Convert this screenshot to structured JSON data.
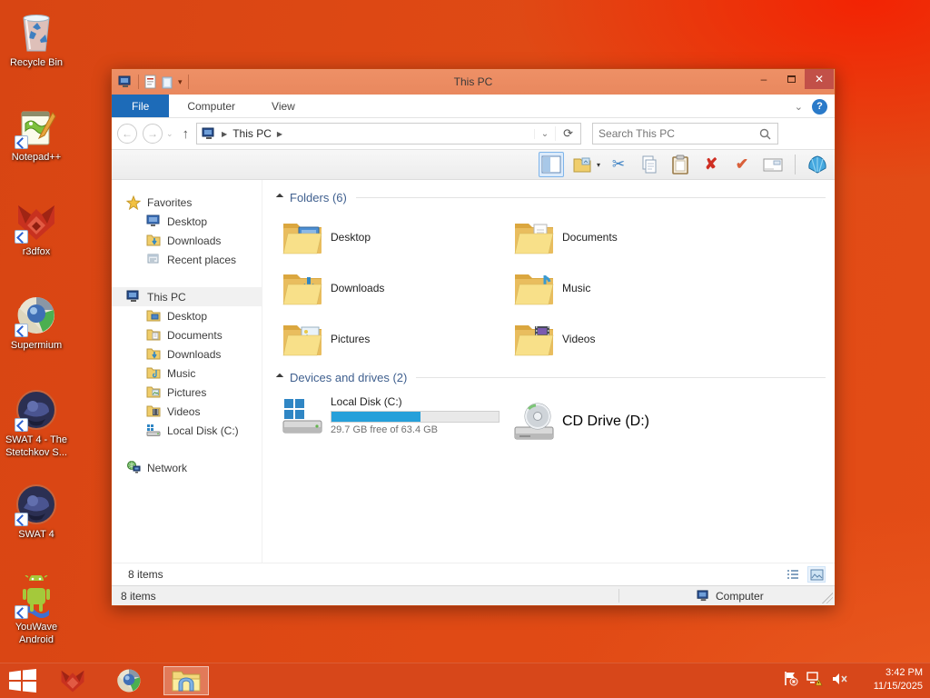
{
  "desktop": {
    "icons": [
      {
        "label": "Recycle Bin"
      },
      {
        "label": "Notepad++"
      },
      {
        "label": "r3dfox"
      },
      {
        "label": "Supermium"
      },
      {
        "label": "SWAT 4 - The Stetchkov S..."
      },
      {
        "label": "SWAT 4"
      },
      {
        "label": "YouWave Android"
      }
    ]
  },
  "window": {
    "title": "This PC",
    "quick_access_icons": [
      "system-menu-computer",
      "properties",
      "new-folder",
      "customize-caret"
    ],
    "tabs": {
      "file": "File",
      "computer": "Computer",
      "view": "View"
    },
    "nav": {
      "address_root": "This PC",
      "search_placeholder": "Search This PC"
    },
    "toolbar_icons": [
      "preview-pane-toggle",
      "folder-options",
      "cut",
      "copy",
      "paste",
      "delete",
      "properties-check",
      "email",
      "classic-shell-settings"
    ],
    "sidebar": {
      "favorites": {
        "label": "Favorites",
        "items": [
          {
            "label": "Desktop"
          },
          {
            "label": "Downloads"
          },
          {
            "label": "Recent places"
          }
        ]
      },
      "thispc": {
        "label": "This PC",
        "items": [
          {
            "label": "Desktop"
          },
          {
            "label": "Documents"
          },
          {
            "label": "Downloads"
          },
          {
            "label": "Music"
          },
          {
            "label": "Pictures"
          },
          {
            "label": "Videos"
          },
          {
            "label": "Local Disk (C:)"
          }
        ]
      },
      "network": {
        "label": "Network"
      }
    },
    "main": {
      "folders": {
        "header": "Folders (6)",
        "items": [
          "Desktop",
          "Documents",
          "Downloads",
          "Music",
          "Pictures",
          "Videos"
        ]
      },
      "devices": {
        "header": "Devices and drives (2)",
        "local_disk": {
          "label": "Local Disk (C:)",
          "free_text": "29.7 GB free of 63.4 GB",
          "used_percent": 53,
          "bar_fill_style": "width:53%",
          "bar_color": "#26a0da"
        },
        "cd_drive": {
          "label": "CD Drive (D:)"
        }
      }
    },
    "status": {
      "items_text": "8 items",
      "classic_items_text": "8 items",
      "location_label": "Computer"
    }
  },
  "taskbar": {
    "buttons": [
      "start",
      "r3dfox",
      "supermium",
      "file-explorer-active"
    ],
    "tray_icons": [
      "action-center-flag-error",
      "network-warning",
      "volume-muted"
    ],
    "tray": {
      "time": "3:42 PM",
      "date": "11/15/2025"
    }
  },
  "colors": {
    "desktop": "#e04a15",
    "titlebar": "#ec8d62",
    "ribbon_accent": "#1d6bb8",
    "close_button": "#c25048",
    "disk_bar": "#26a0da",
    "group_header": "#40608f"
  },
  "glyphs": {
    "minimize": "–",
    "close": "✕",
    "help": "?",
    "ribbon_collapse": "⌄",
    "back": "←",
    "forward": "→",
    "up": "↑",
    "nav_chevron": "⌄",
    "crumb": "▶",
    "address_dropdown": "⌄",
    "refresh": "⟳",
    "qat_caret": "▾",
    "cut": "✂",
    "delete": "✘",
    "check": "✔",
    "mail": "✉",
    "toolbar_dropdown": "▾"
  }
}
